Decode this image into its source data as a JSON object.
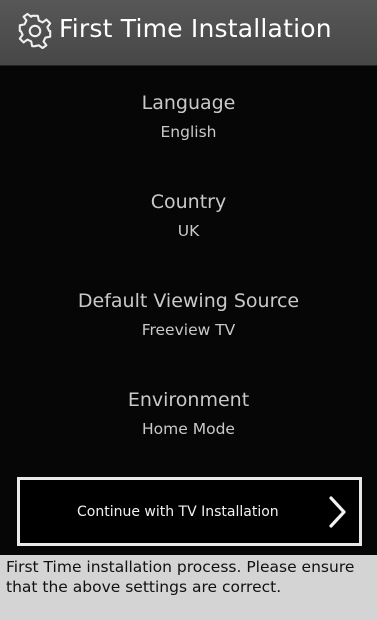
{
  "header": {
    "icon": "gear-icon",
    "title": "First Time Installation"
  },
  "settings": [
    {
      "label": "Language",
      "value": "English"
    },
    {
      "label": "Country",
      "value": "UK"
    },
    {
      "label": "Default Viewing Source",
      "value": "Freeview TV"
    },
    {
      "label": "Environment",
      "value": "Home Mode"
    }
  ],
  "continue": {
    "label": "Continue with TV Installation",
    "icon": "chevron-right-icon"
  },
  "footer": {
    "text": "First Time installation process. Please ensure that the above settings are correct."
  },
  "colors": {
    "background": "#060606",
    "header": "#505050",
    "footer": "#d4d4d4",
    "text": "#c9c9c9"
  }
}
